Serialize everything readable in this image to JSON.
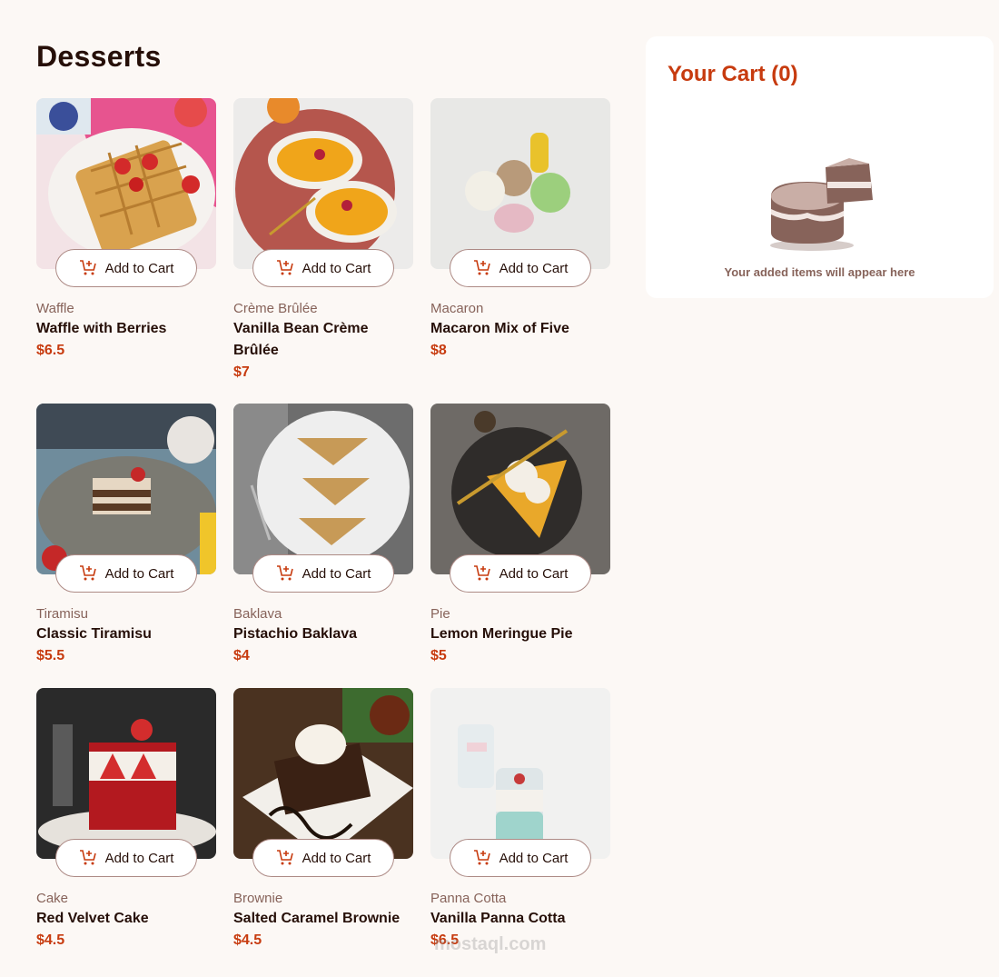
{
  "page": {
    "title": "Desserts"
  },
  "add_to_cart_label": "Add to Cart",
  "products": [
    {
      "category": "Waffle",
      "name": "Waffle with Berries",
      "price": "$6.5"
    },
    {
      "category": "Crème Brûlée",
      "name": "Vanilla Bean Crème Brûlée",
      "price": "$7"
    },
    {
      "category": "Macaron",
      "name": "Macaron Mix of Five",
      "price": "$8"
    },
    {
      "category": "Tiramisu",
      "name": "Classic Tiramisu",
      "price": "$5.5"
    },
    {
      "category": "Baklava",
      "name": "Pistachio Baklava",
      "price": "$4"
    },
    {
      "category": "Pie",
      "name": "Lemon Meringue Pie",
      "price": "$5"
    },
    {
      "category": "Cake",
      "name": "Red Velvet Cake",
      "price": "$4.5"
    },
    {
      "category": "Brownie",
      "name": "Salted Caramel Brownie",
      "price": "$4.5"
    },
    {
      "category": "Panna Cotta",
      "name": "Vanilla Panna Cotta",
      "price": "$6.5"
    }
  ],
  "cart": {
    "title": "Your Cart (0)",
    "empty_message": "Your added items will appear here"
  },
  "watermark": "mostaql.com",
  "colors": {
    "accent": "#c73b0f",
    "background": "#fcf8f5",
    "muted": "#87635a"
  }
}
